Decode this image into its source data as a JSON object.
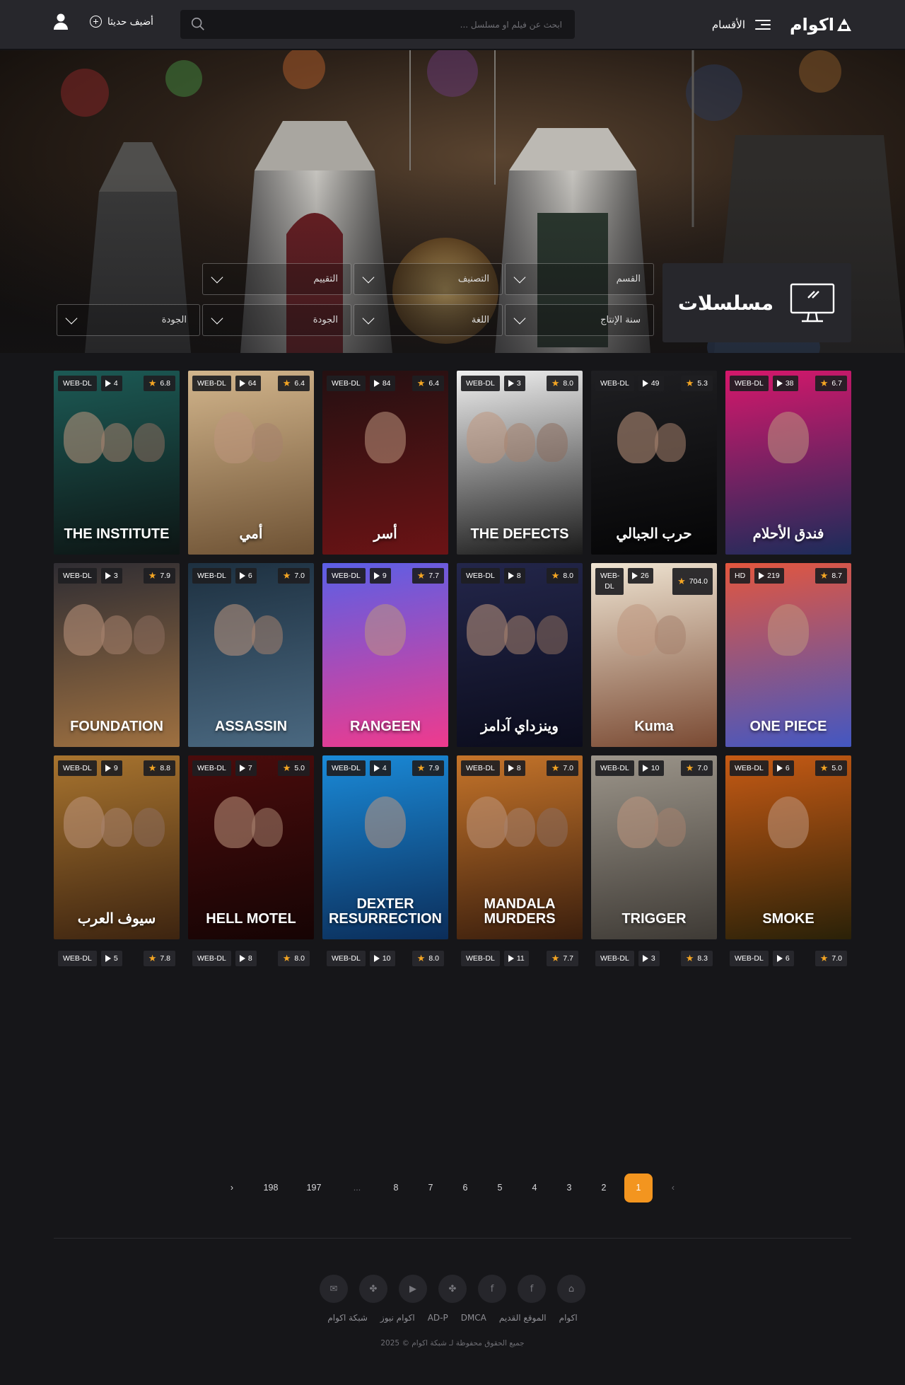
{
  "header": {
    "logo_text": "اكوام",
    "menu_label": "الأقسام",
    "search_placeholder": "ابحث عن فيلم او مسلسل ...",
    "add_new_label": "أضيف حديثا"
  },
  "page_title": "مسلسلات",
  "filters": [
    {
      "label": "القسم"
    },
    {
      "label": "التصنيف"
    },
    {
      "label": "التقييم"
    },
    {
      "label": "سنة الإنتاج"
    },
    {
      "label": "اللغة"
    },
    {
      "label": "الجودة"
    },
    {
      "label": "الجودة"
    }
  ],
  "cards": [
    {
      "title": "فندق الأحلام",
      "quality": "WEB-DL",
      "episodes": "38",
      "rating": "6.7",
      "poster_colors": [
        "#d6176b",
        "#1c2c5a"
      ]
    },
    {
      "title": "حرب الجبالي",
      "quality": "WEB-DL",
      "episodes": "49",
      "rating": "5.3",
      "poster_colors": [
        "#1f1f22",
        "#050506"
      ]
    },
    {
      "title": "THE DEFECTS",
      "quality": "WEB-DL",
      "episodes": "3",
      "rating": "8.0",
      "poster_colors": [
        "#f0f0f0",
        "#1a1a1a"
      ]
    },
    {
      "title": "أسر",
      "quality": "WEB-DL",
      "episodes": "84",
      "rating": "6.4",
      "poster_colors": [
        "#241011",
        "#6b1315"
      ]
    },
    {
      "title": "أمي",
      "quality": "WEB-DL",
      "episodes": "64",
      "rating": "6.4",
      "poster_colors": [
        "#d2b58c",
        "#6e5234"
      ]
    },
    {
      "title": "THE INSTITUTE",
      "quality": "WEB-DL",
      "episodes": "4",
      "rating": "6.8",
      "poster_colors": [
        "#1c5a55",
        "#0d1514"
      ]
    },
    {
      "title": "ONE PIECE",
      "quality": "HD",
      "episodes": "219",
      "rating": "8.7",
      "poster_colors": [
        "#e3563e",
        "#4357c2"
      ]
    },
    {
      "title": "Kuma",
      "quality": "WEB-DL",
      "episodes": "26",
      "rating": "704.0",
      "poster_colors": [
        "#efe4d2",
        "#7a4a33"
      ]
    },
    {
      "title": "وينزداي آدامز",
      "quality": "WEB-DL",
      "episodes": "8",
      "rating": "8.0",
      "poster_colors": [
        "#23264a",
        "#0b0c1c"
      ]
    },
    {
      "title": "RANGEEN",
      "quality": "WEB-DL",
      "episodes": "9",
      "rating": "7.7",
      "poster_colors": [
        "#5b5fe6",
        "#ef3a8d"
      ]
    },
    {
      "title": "ASSASSIN",
      "quality": "WEB-DL",
      "episodes": "6",
      "rating": "7.0",
      "poster_colors": [
        "#1d3040",
        "#4a6880"
      ]
    },
    {
      "title": "FOUNDATION",
      "quality": "WEB-DL",
      "episodes": "3",
      "rating": "7.9",
      "poster_colors": [
        "#2f2d33",
        "#9e7040"
      ]
    },
    {
      "title": "SMOKE",
      "quality": "WEB-DL",
      "episodes": "6",
      "rating": "5.0",
      "poster_colors": [
        "#c65a14",
        "#2a2108"
      ]
    },
    {
      "title": "TRIGGER",
      "quality": "WEB-DL",
      "episodes": "10",
      "rating": "7.0",
      "poster_colors": [
        "#9c958a",
        "#3e3a35"
      ]
    },
    {
      "title": "MANDALA MURDERS",
      "quality": "WEB-DL",
      "episodes": "8",
      "rating": "7.0",
      "poster_colors": [
        "#c5742a",
        "#3a1e0d"
      ]
    },
    {
      "title": "DEXTER RESURRECTION",
      "quality": "WEB-DL",
      "episodes": "4",
      "rating": "7.9",
      "poster_colors": [
        "#1a8ad8",
        "#0b2d59"
      ]
    },
    {
      "title": "HELL MOTEL",
      "quality": "WEB-DL",
      "episodes": "7",
      "rating": "5.0",
      "poster_colors": [
        "#4a0c0c",
        "#160404"
      ]
    },
    {
      "title": "سيوف العرب",
      "quality": "WEB-DL",
      "episodes": "9",
      "rating": "8.8",
      "poster_colors": [
        "#a8742f",
        "#3d2410"
      ]
    }
  ],
  "row4": [
    {
      "quality": "WEB-DL",
      "episodes": "6",
      "rating": "7.0"
    },
    {
      "quality": "WEB-DL",
      "episodes": "3",
      "rating": "8.3"
    },
    {
      "quality": "WEB-DL",
      "episodes": "11",
      "rating": "7.7"
    },
    {
      "quality": "WEB-DL",
      "episodes": "10",
      "rating": "8.0"
    },
    {
      "quality": "WEB-DL",
      "episodes": "8",
      "rating": "8.0"
    },
    {
      "quality": "WEB-DL",
      "episodes": "5",
      "rating": "7.8"
    }
  ],
  "pagination": {
    "prev": "‹",
    "pages": [
      "1",
      "2",
      "3",
      "4",
      "5",
      "6",
      "7",
      "8",
      "...",
      "197",
      "198"
    ],
    "next": "›",
    "active": "1"
  },
  "footer": {
    "social_icons": [
      "home-icon",
      "facebook-icon",
      "facebook-icon",
      "apps-icon",
      "youtube-icon",
      "apps-icon",
      "mail-icon"
    ],
    "links": [
      "اكوام",
      "الموقع القديم",
      "DMCA",
      "AD-P",
      "اكوام نيوز",
      "شبكة اكوام"
    ],
    "copyright": "جميع الحقوق محفوظة لـ شبكة اكوام © 2025"
  },
  "colors": {
    "background": "#161619",
    "header": "#27272c",
    "accent": "#f3951f",
    "star": "#f5a623"
  }
}
